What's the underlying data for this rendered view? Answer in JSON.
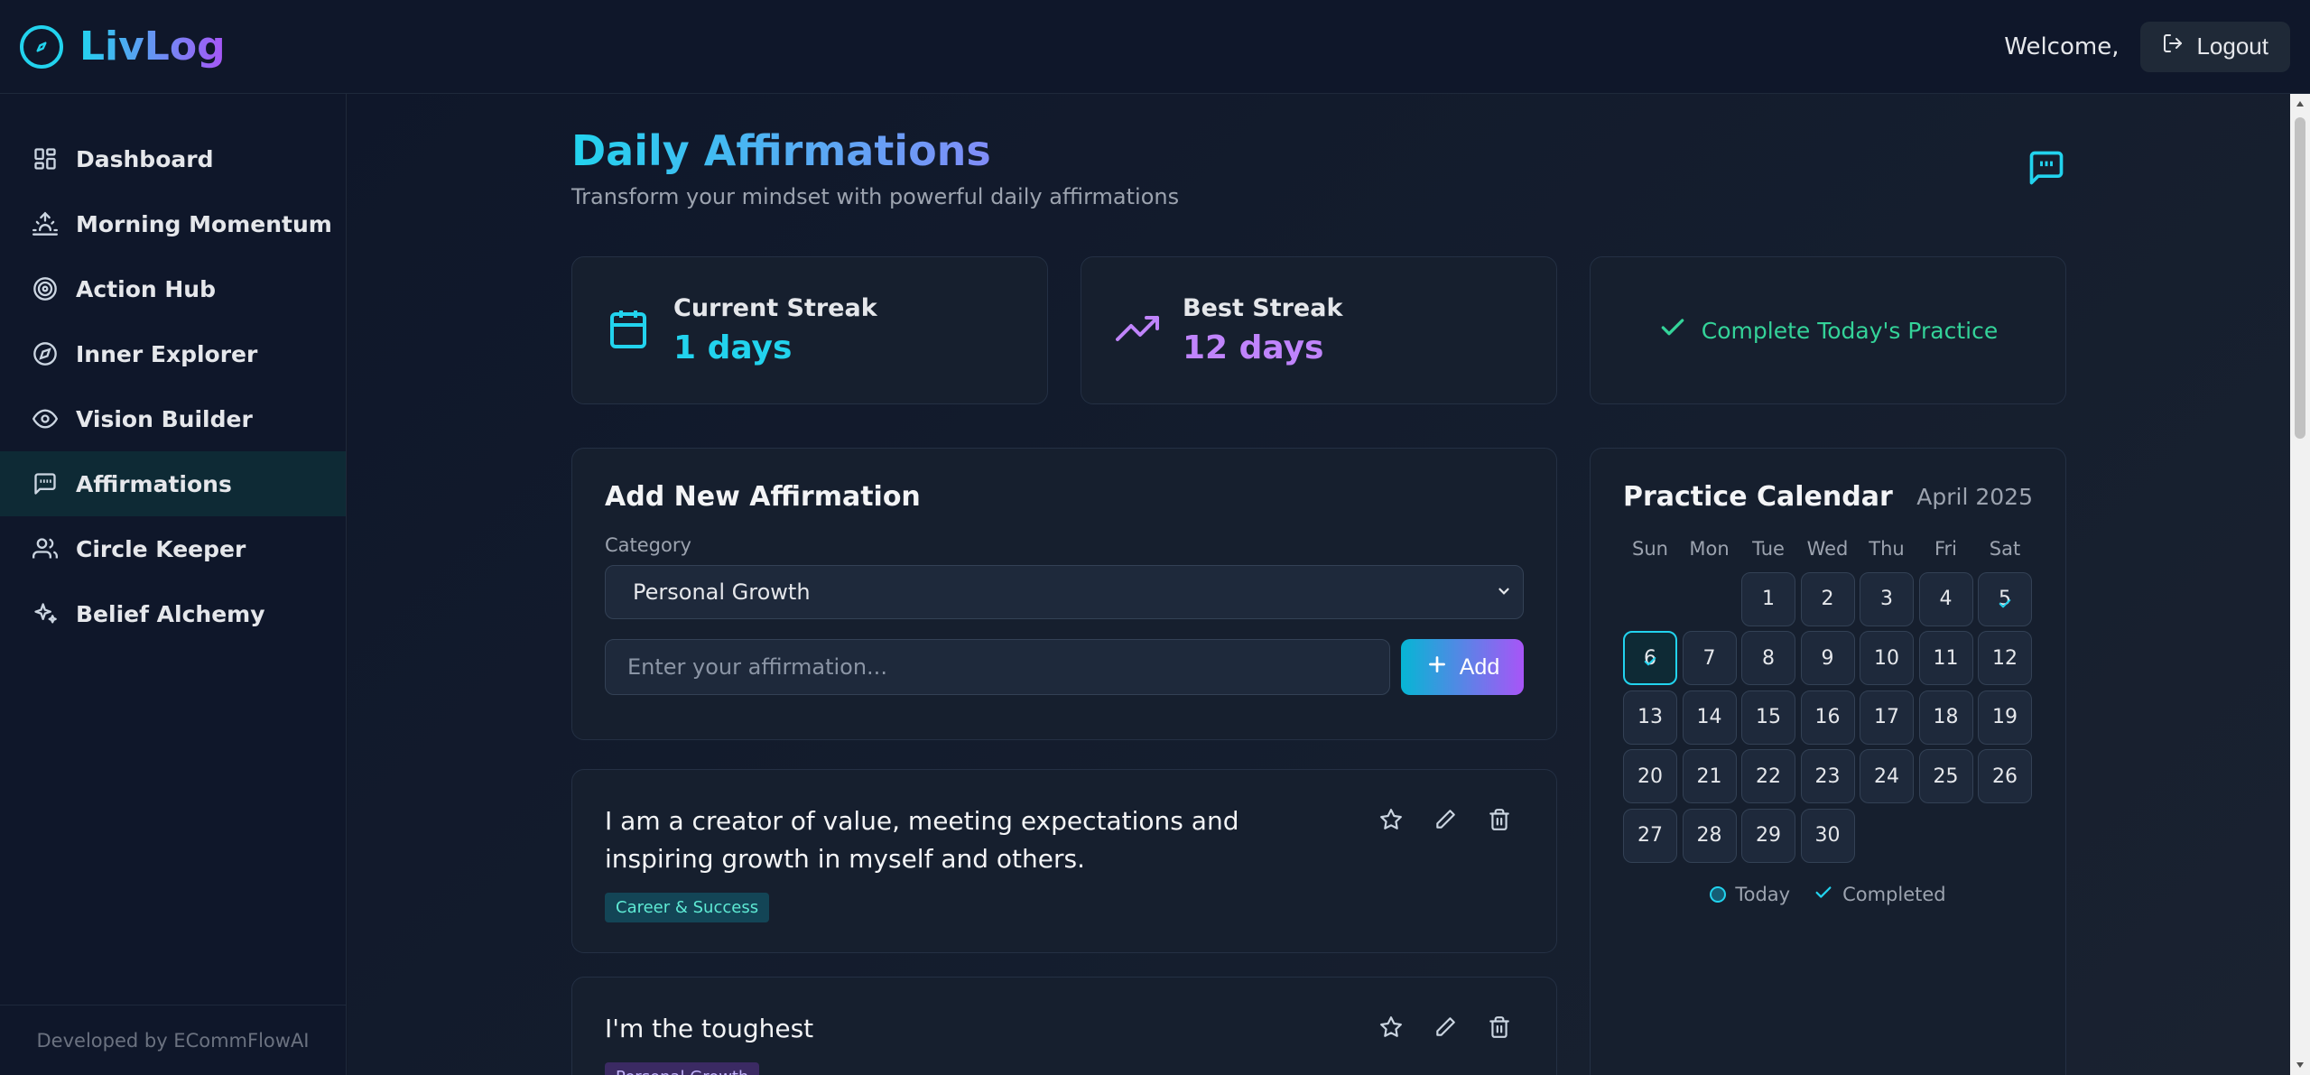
{
  "app": {
    "name": "LivLog"
  },
  "header": {
    "welcome": "Welcome,",
    "logout": "Logout"
  },
  "sidebar": {
    "items": [
      {
        "label": "Dashboard",
        "icon": "dashboard-icon"
      },
      {
        "label": "Morning Momentum",
        "icon": "sunrise-icon"
      },
      {
        "label": "Action Hub",
        "icon": "target-icon"
      },
      {
        "label": "Inner Explorer",
        "icon": "compass-icon"
      },
      {
        "label": "Vision Builder",
        "icon": "eye-icon"
      },
      {
        "label": "Affirmations",
        "icon": "quote-message-icon",
        "active": true
      },
      {
        "label": "Circle Keeper",
        "icon": "users-icon"
      },
      {
        "label": "Belief Alchemy",
        "icon": "sparkles-icon"
      }
    ],
    "footer": "Developed by ECommFlowAI"
  },
  "page": {
    "title": "Daily Affirmations",
    "subtitle": "Transform your mindset with powerful daily affirmations"
  },
  "stats": {
    "current": {
      "label": "Current Streak",
      "value": "1 days",
      "color": "#22d3ee"
    },
    "best": {
      "label": "Best Streak",
      "value": "12 days",
      "color": "#c084fc"
    },
    "complete_label": "Complete Today's Practice"
  },
  "add_form": {
    "title": "Add New Affirmation",
    "category_label": "Category",
    "category_value": "Personal Growth",
    "input_placeholder": "Enter your affirmation...",
    "add_label": "Add"
  },
  "affirmations": [
    {
      "text": "I am a creator of value, meeting expectations and inspiring growth in myself and others.",
      "category": "Career & Success"
    },
    {
      "text": "I'm the toughest",
      "category": "Personal Growth"
    }
  ],
  "calendar": {
    "title": "Practice Calendar",
    "month": "April 2025",
    "weekdays": [
      "Sun",
      "Mon",
      "Tue",
      "Wed",
      "Thu",
      "Fri",
      "Sat"
    ],
    "leading_blanks": 2,
    "days": [
      "1",
      "2",
      "3",
      "4",
      "5",
      "6",
      "7",
      "8",
      "9",
      "10",
      "11",
      "12",
      "13",
      "14",
      "15",
      "16",
      "17",
      "18",
      "19",
      "20",
      "21",
      "22",
      "23",
      "24",
      "25",
      "26",
      "27",
      "28",
      "29",
      "30"
    ],
    "today": "6",
    "completed": [
      "5",
      "6"
    ],
    "legend_today": "Today",
    "legend_completed": "Completed"
  },
  "colors": {
    "accent": "#22d3ee",
    "purple": "#a855f7",
    "success": "#34d399"
  }
}
